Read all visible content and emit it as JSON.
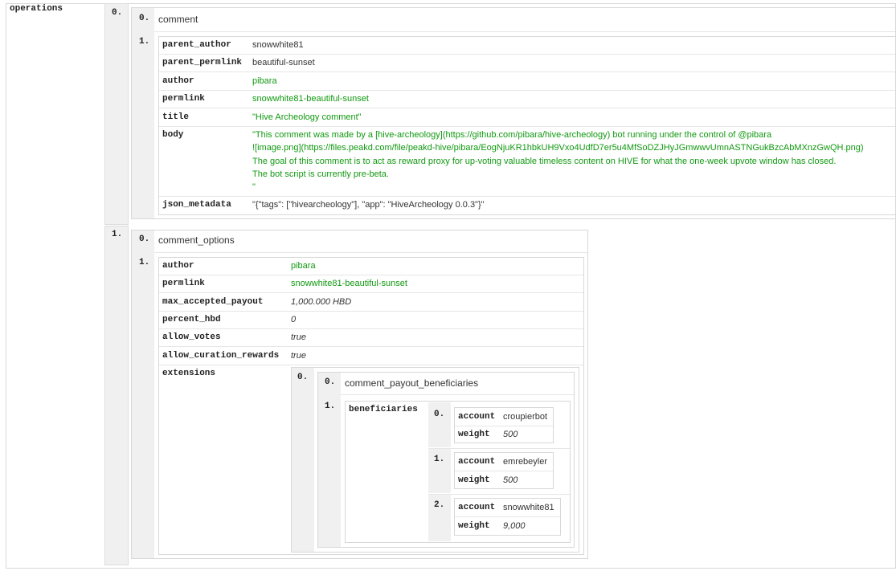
{
  "root": {
    "key": "operations"
  },
  "operations": [
    {
      "index": "0.",
      "type_index": "0.",
      "type": "comment",
      "value_index": "1.",
      "fields": {
        "parent_author": {
          "key": "parent_author",
          "value": "snowwhite81"
        },
        "parent_permlink": {
          "key": "parent_permlink",
          "value": "beautiful-sunset"
        },
        "author": {
          "key": "author",
          "value": "pibara"
        },
        "permlink": {
          "key": "permlink",
          "value": "snowwhite81-beautiful-sunset"
        },
        "title": {
          "key": "title",
          "value": "\"Hive Archeology comment\""
        },
        "body": {
          "key": "body",
          "lines": [
            "\"This comment was made by a [hive-archeology](https://github.com/pibara/hive-archeology) bot running under the control of @pibara",
            "![image.png](https://files.peakd.com/file/peakd-hive/pibara/EogNjuKR1hbkUH9Vxo4UdfD7er5u4MfSoDZJHyJGmwwvUmnASTNGukBzcAbMXnzGwQH.png)",
            "The goal of this comment is to act as reward proxy for up-voting valuable timeless content on HIVE for what the one-week upvote window has closed.",
            "The bot script is currently pre-beta.",
            "\""
          ]
        },
        "json_metadata": {
          "key": "json_metadata",
          "value": "\"{\"tags\": [\"hivearcheology\"], \"app\": \"HiveArcheology 0.0.3\"}\""
        }
      }
    },
    {
      "index": "1.",
      "type_index": "0.",
      "type": "comment_options",
      "value_index": "1.",
      "fields": {
        "author": {
          "key": "author",
          "value": "pibara"
        },
        "permlink": {
          "key": "permlink",
          "value": "snowwhite81-beautiful-sunset"
        },
        "max_accepted_payout": {
          "key": "max_accepted_payout",
          "value": "1,000.000 HBD"
        },
        "percent_hbd": {
          "key": "percent_hbd",
          "value": "0"
        },
        "allow_votes": {
          "key": "allow_votes",
          "value": "true"
        },
        "allow_curation_rewards": {
          "key": "allow_curation_rewards",
          "value": "true"
        },
        "extensions": {
          "key": "extensions",
          "index": "0.",
          "type_index": "0.",
          "type": "comment_payout_beneficiaries",
          "value_index": "1.",
          "beneficiaries_key": "beneficiaries",
          "beneficiaries": [
            {
              "index": "0.",
              "account_key": "account",
              "account": "croupierbot",
              "weight_key": "weight",
              "weight": "500"
            },
            {
              "index": "1.",
              "account_key": "account",
              "account": "emrebeyler",
              "weight_key": "weight",
              "weight": "500"
            },
            {
              "index": "2.",
              "account_key": "account",
              "account": "snowwhite81",
              "weight_key": "weight",
              "weight": "9,000"
            }
          ]
        }
      }
    }
  ]
}
